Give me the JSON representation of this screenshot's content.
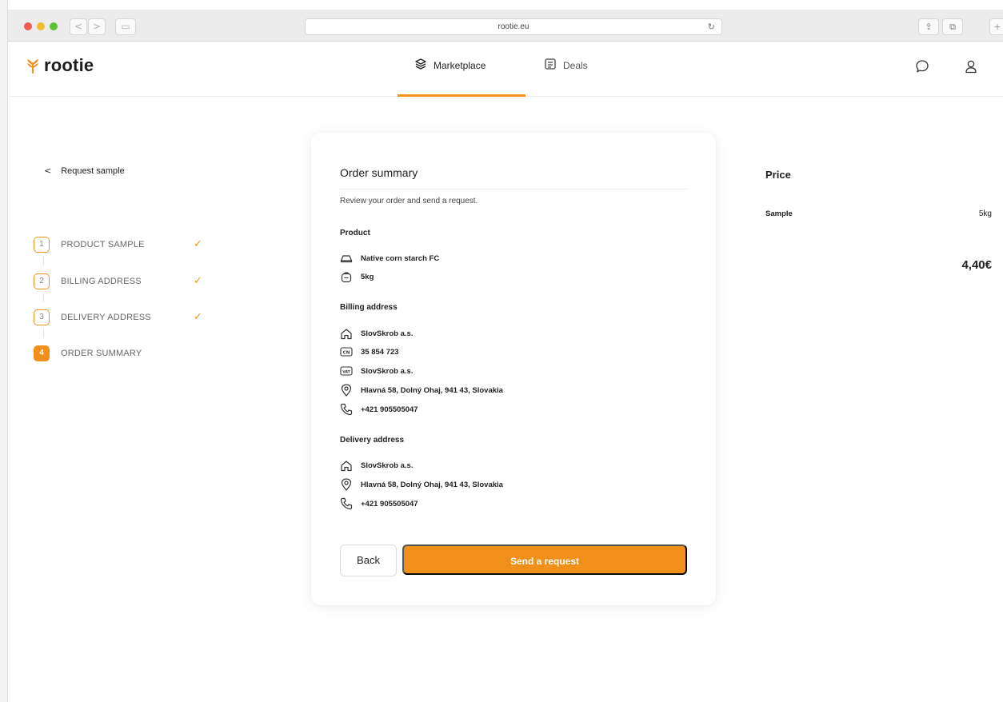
{
  "browser": {
    "url": "rootie.eu",
    "back_glyph": "<",
    "forward_glyph": ">",
    "sidebar_glyph": "▭",
    "reload_glyph": "↻",
    "share_glyph": "⇪",
    "tabs_glyph": "⧉",
    "newtab_glyph": "+"
  },
  "header": {
    "logo_text": "rootie",
    "nav": [
      {
        "label": "Marketplace",
        "icon": "layers-icon",
        "active": true
      },
      {
        "label": "Deals",
        "icon": "deals-icon",
        "active": false
      }
    ],
    "accent": "#f0901a"
  },
  "sidebar": {
    "back_glyph": "<",
    "back_label": "Request sample",
    "steps": [
      {
        "number": "1",
        "label": "PRODUCT SAMPLE",
        "status": "done",
        "check": "✓"
      },
      {
        "number": "2",
        "label": "BILLING ADDRESS",
        "status": "done",
        "check": "✓"
      },
      {
        "number": "3",
        "label": "DELIVERY ADDRESS",
        "status": "done",
        "check": "✓"
      },
      {
        "number": "4",
        "label": "ORDER SUMMARY",
        "status": "active",
        "check": ""
      }
    ]
  },
  "order": {
    "title": "Order summary",
    "subtitle": "Review your order and send a request.",
    "product": {
      "heading": "Product",
      "name": "Native corn starch FC",
      "quantity": "5kg"
    },
    "billing": {
      "heading": "Billing address",
      "company": "SlovSkrob a.s.",
      "company_id_tag": "CN",
      "company_id": "35 854 723",
      "vat_tag": "VAT",
      "vat_name": "SlovSkrob a.s.",
      "address": "Hlavná 58, Dolný Ohaj, 941 43, Slovakia",
      "phone": "+421 905505047"
    },
    "delivery": {
      "heading": "Delivery address",
      "company": "SlovSkrob a.s.",
      "address": "Hlavná 58, Dolný Ohaj, 941 43, Slovakia",
      "phone": "+421 905505047"
    },
    "back_label": "Back",
    "send_label": "Send a request"
  },
  "price": {
    "title": "Price",
    "row_label": "Sample",
    "row_value": "5kg",
    "total": "4,40€"
  }
}
